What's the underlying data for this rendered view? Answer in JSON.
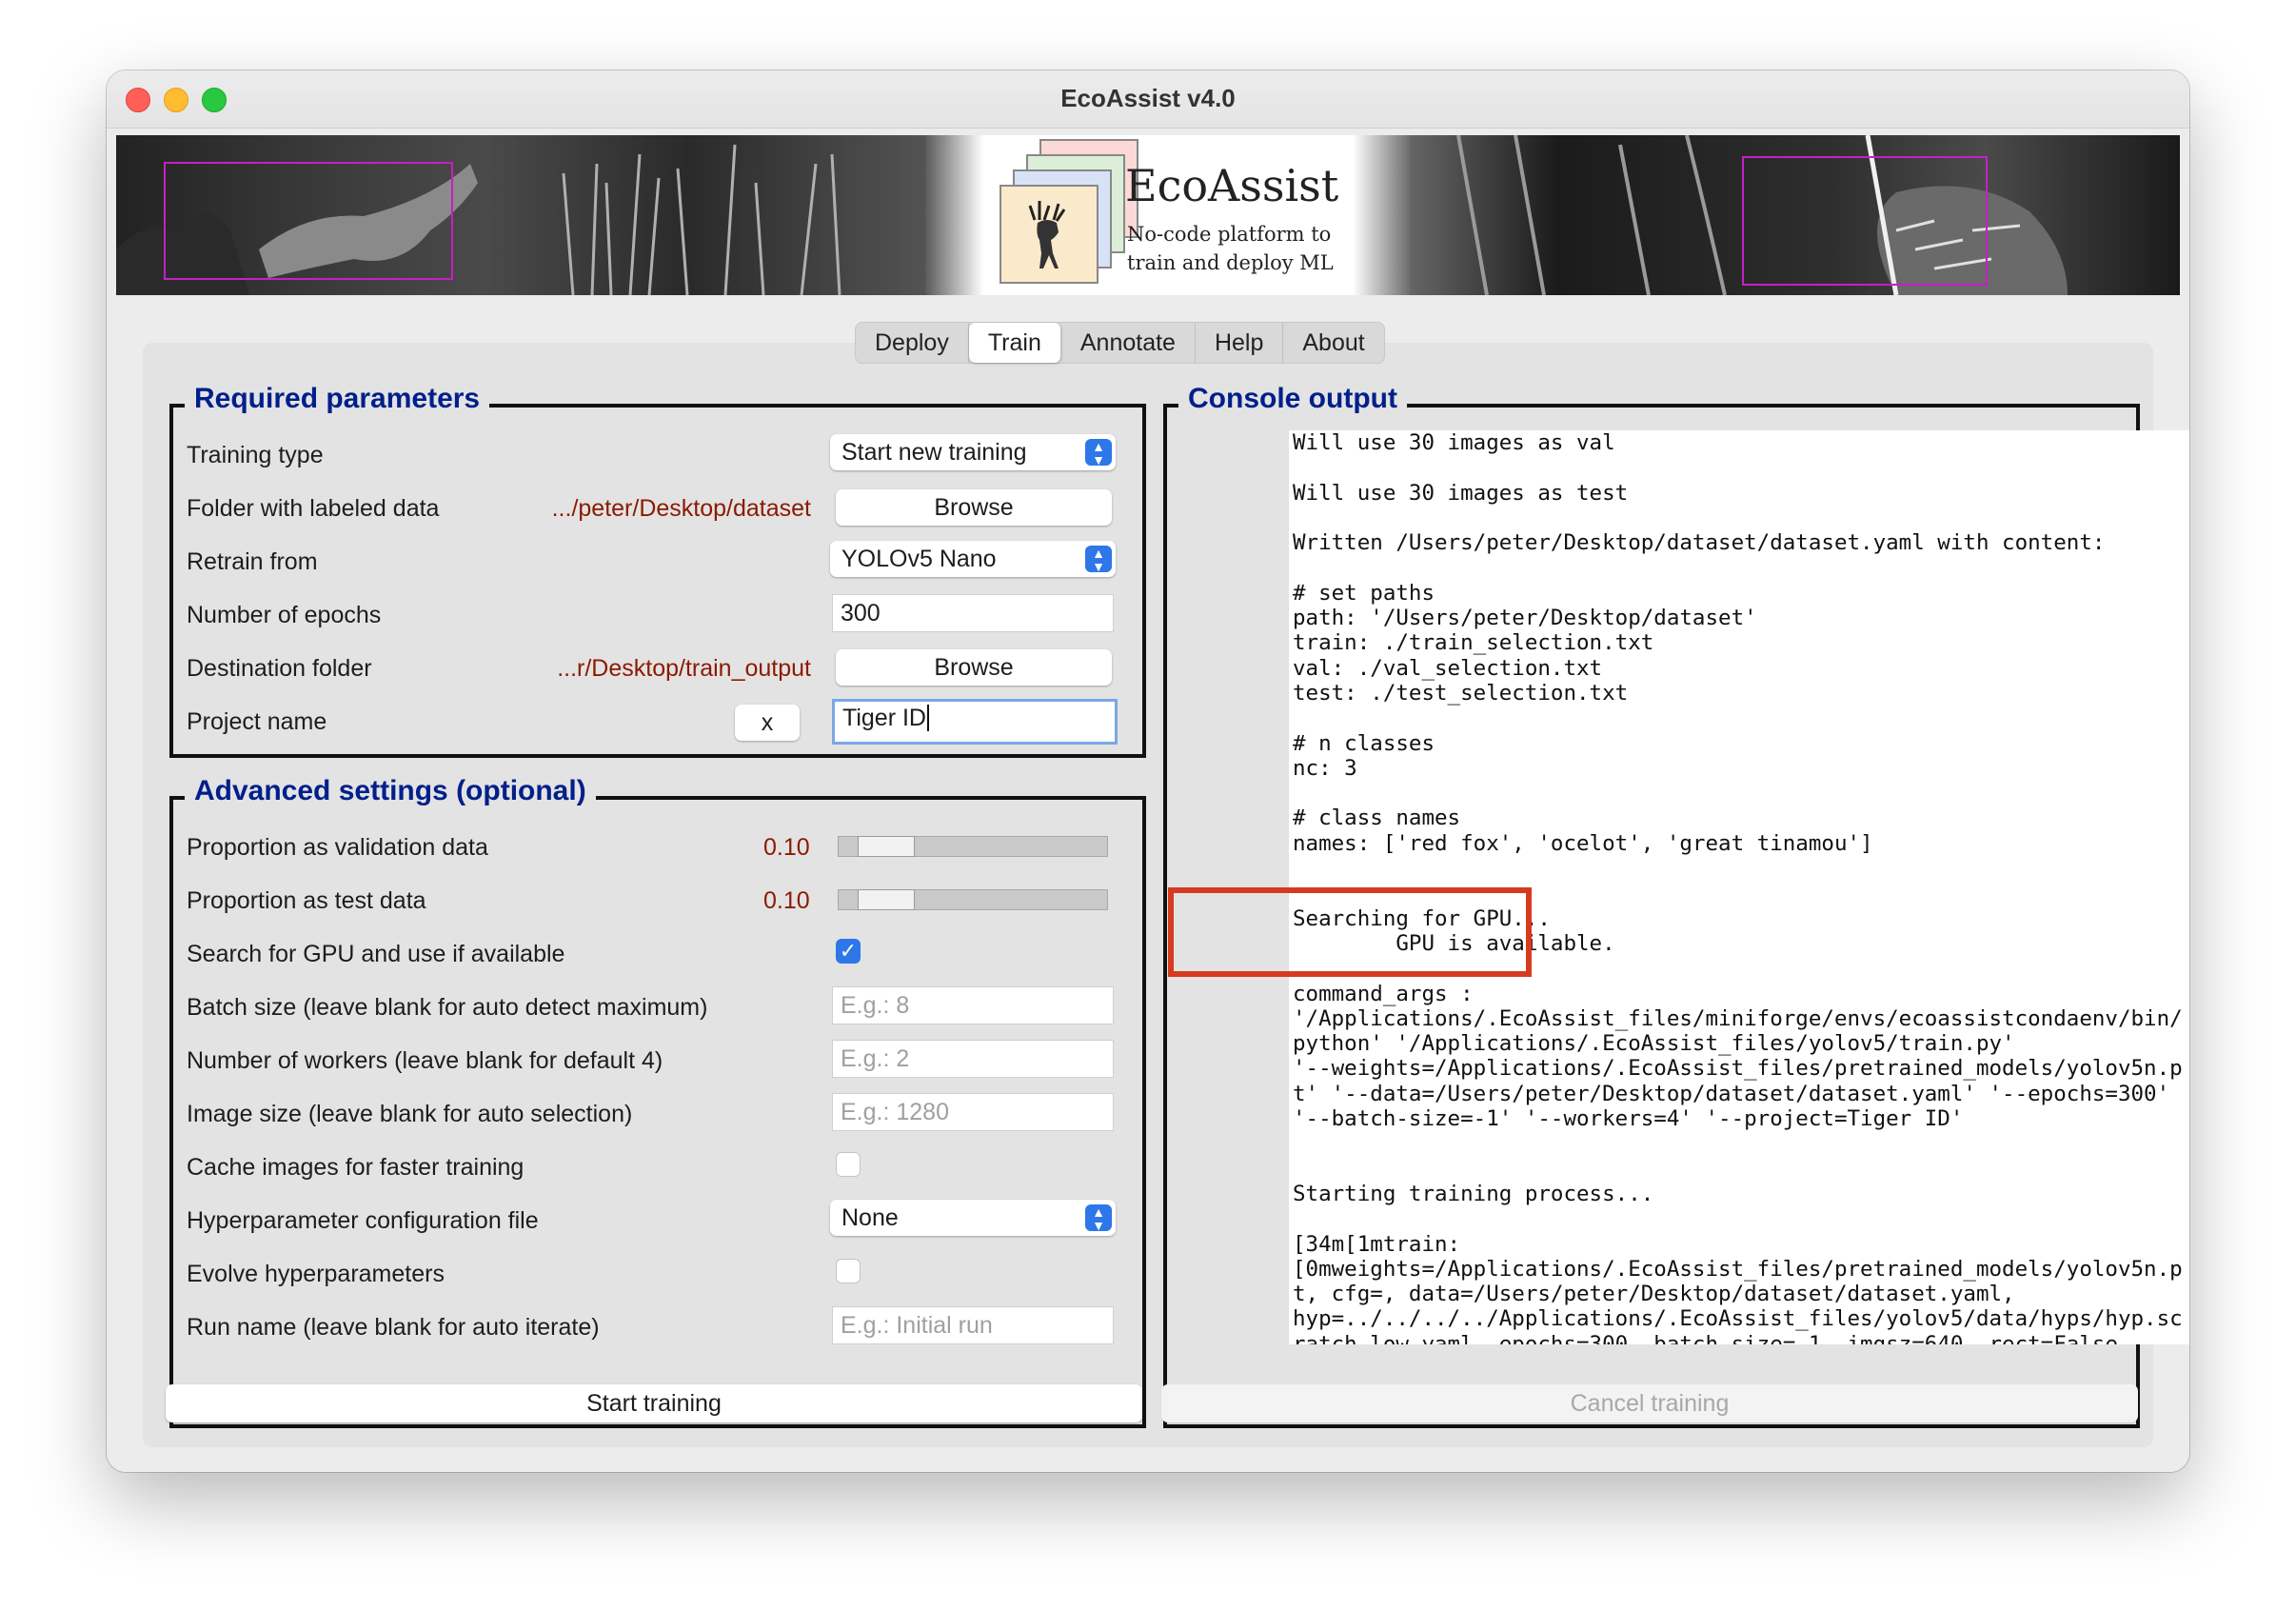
{
  "window": {
    "title": "EcoAssist v4.0"
  },
  "banner": {
    "logo_title": "EcoAssist",
    "logo_subtitle_1": "No-code platform to",
    "logo_subtitle_2": "train and deploy ML"
  },
  "tabs": [
    {
      "label": "Deploy"
    },
    {
      "label": "Train"
    },
    {
      "label": "Annotate"
    },
    {
      "label": "Help"
    },
    {
      "label": "About"
    }
  ],
  "active_tab": "Train",
  "required": {
    "title": "Required parameters",
    "training_type": {
      "label": "Training type",
      "value": "Start new training"
    },
    "folder_labeled": {
      "label": "Folder with labeled data",
      "path": ".../peter/Desktop/dataset",
      "button": "Browse"
    },
    "retrain_from": {
      "label": "Retrain from",
      "value": "YOLOv5 Nano"
    },
    "epochs": {
      "label": "Number of epochs",
      "value": "300"
    },
    "destination": {
      "label": "Destination folder",
      "path": "...r/Desktop/train_output",
      "button": "Browse"
    },
    "project_name": {
      "label": "Project name",
      "clear_button": "x",
      "value": "Tiger ID"
    }
  },
  "advanced": {
    "title": "Advanced settings (optional)",
    "val_prop": {
      "label": "Proportion as validation data",
      "value": "0.10",
      "slider_fraction": 0.1
    },
    "test_prop": {
      "label": "Proportion as test data",
      "value": "0.10",
      "slider_fraction": 0.1
    },
    "gpu": {
      "label": "Search for GPU and use if available",
      "checked": true
    },
    "batch_size": {
      "label": "Batch size (leave blank for auto detect maximum)",
      "placeholder": "E.g.: 8"
    },
    "workers": {
      "label": "Number of workers (leave blank for default 4)",
      "placeholder": "E.g.: 2"
    },
    "image_size": {
      "label": "Image size (leave blank for auto selection)",
      "placeholder": "E.g.: 1280"
    },
    "cache": {
      "label": "Cache images for faster training",
      "checked": false
    },
    "hyp_file": {
      "label": "Hyperparameter configuration file",
      "value": "None"
    },
    "evolve": {
      "label": "Evolve hyperparameters",
      "checked": false
    },
    "run_name": {
      "label": "Run name (leave blank for auto iterate)",
      "placeholder": "E.g.: Initial run"
    }
  },
  "console": {
    "title": "Console output",
    "text": "Will use 30 images as val\n\nWill use 30 images as test\n\nWritten /Users/peter/Desktop/dataset/dataset.yaml with content:\n\n# set paths\npath: '/Users/peter/Desktop/dataset'\ntrain: ./train_selection.txt\nval: ./val_selection.txt\ntest: ./test_selection.txt\n\n# n classes\nnc: 3\n\n# class names\nnames: ['red fox', 'ocelot', 'great tinamou']\n\n\nSearching for GPU...\n        GPU is available.\n\ncommand_args :\n'/Applications/.EcoAssist_files/miniforge/envs/ecoassistcondaenv/bin/\npython' '/Applications/.EcoAssist_files/yolov5/train.py'\n'--weights=/Applications/.EcoAssist_files/pretrained_models/yolov5n.p\nt' '--data=/Users/peter/Desktop/dataset/dataset.yaml' '--epochs=300'\n'--batch-size=-1' '--workers=4' '--project=Tiger ID'\n\n\nStarting training process...\n\n[34m[1mtrain:\n[0mweights=/Applications/.EcoAssist_files/pretrained_models/yolov5n.p\nt, cfg=, data=/Users/peter/Desktop/dataset/dataset.yaml,\nhyp=../../../../Applications/.EcoAssist_files/yolov5/data/hyps/hyp.sc\nratch-low.yaml, epochs=300, batch_size=-1, imgsz=640, rect=False,"
  },
  "buttons": {
    "start": "Start training",
    "cancel": "Cancel training"
  },
  "colors": {
    "accent": "#2d77e8",
    "group_title": "#001f8b",
    "path_text": "#8b1a00",
    "highlight": "#d63b20"
  }
}
